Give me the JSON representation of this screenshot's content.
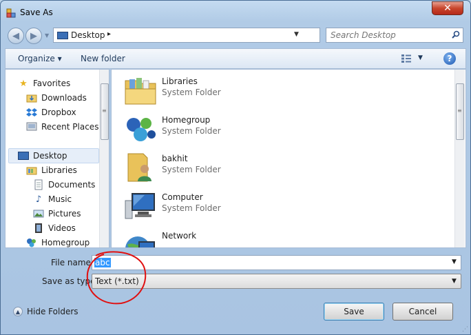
{
  "window": {
    "title": "Save As",
    "close_glyph": "✕"
  },
  "address": {
    "location": "Desktop",
    "separator": "▸"
  },
  "search": {
    "placeholder": "Search Desktop"
  },
  "toolbar": {
    "organize": "Organize ▾",
    "new_folder": "New folder",
    "help": "?"
  },
  "nav": {
    "items": [
      {
        "label": "Favorites",
        "icon": "star-icon"
      },
      {
        "label": "Downloads",
        "icon": "downloads-folder-icon"
      },
      {
        "label": "Dropbox",
        "icon": "dropbox-icon"
      },
      {
        "label": "Recent Places",
        "icon": "recent-places-icon"
      },
      {
        "label": "Desktop",
        "icon": "desktop-icon"
      },
      {
        "label": "Libraries",
        "icon": "libraries-icon"
      },
      {
        "label": "Documents",
        "icon": "documents-icon"
      },
      {
        "label": "Music",
        "icon": "music-icon"
      },
      {
        "label": "Pictures",
        "icon": "pictures-icon"
      },
      {
        "label": "Videos",
        "icon": "videos-icon"
      },
      {
        "label": "Homegroup",
        "icon": "homegroup-icon"
      }
    ],
    "selected": "Desktop"
  },
  "files": [
    {
      "name": "Libraries",
      "type": "System Folder",
      "icon": "libraries-folder-icon"
    },
    {
      "name": "Homegroup",
      "type": "System Folder",
      "icon": "homegroup-icon"
    },
    {
      "name": "bakhit",
      "type": "System Folder",
      "icon": "user-folder-icon"
    },
    {
      "name": "Computer",
      "type": "System Folder",
      "icon": "computer-icon"
    },
    {
      "name": "Network",
      "type": "",
      "icon": "network-icon"
    }
  ],
  "form": {
    "file_name_label": "File name:",
    "file_name_value": "abc",
    "save_as_type_label": "Save as type:",
    "save_as_type_value": "Text (*.txt)"
  },
  "footer": {
    "hide_folders": "Hide Folders",
    "save": "Save",
    "cancel": "Cancel"
  },
  "colors": {
    "annotation": "#e01010",
    "selection": "#3399ff"
  }
}
